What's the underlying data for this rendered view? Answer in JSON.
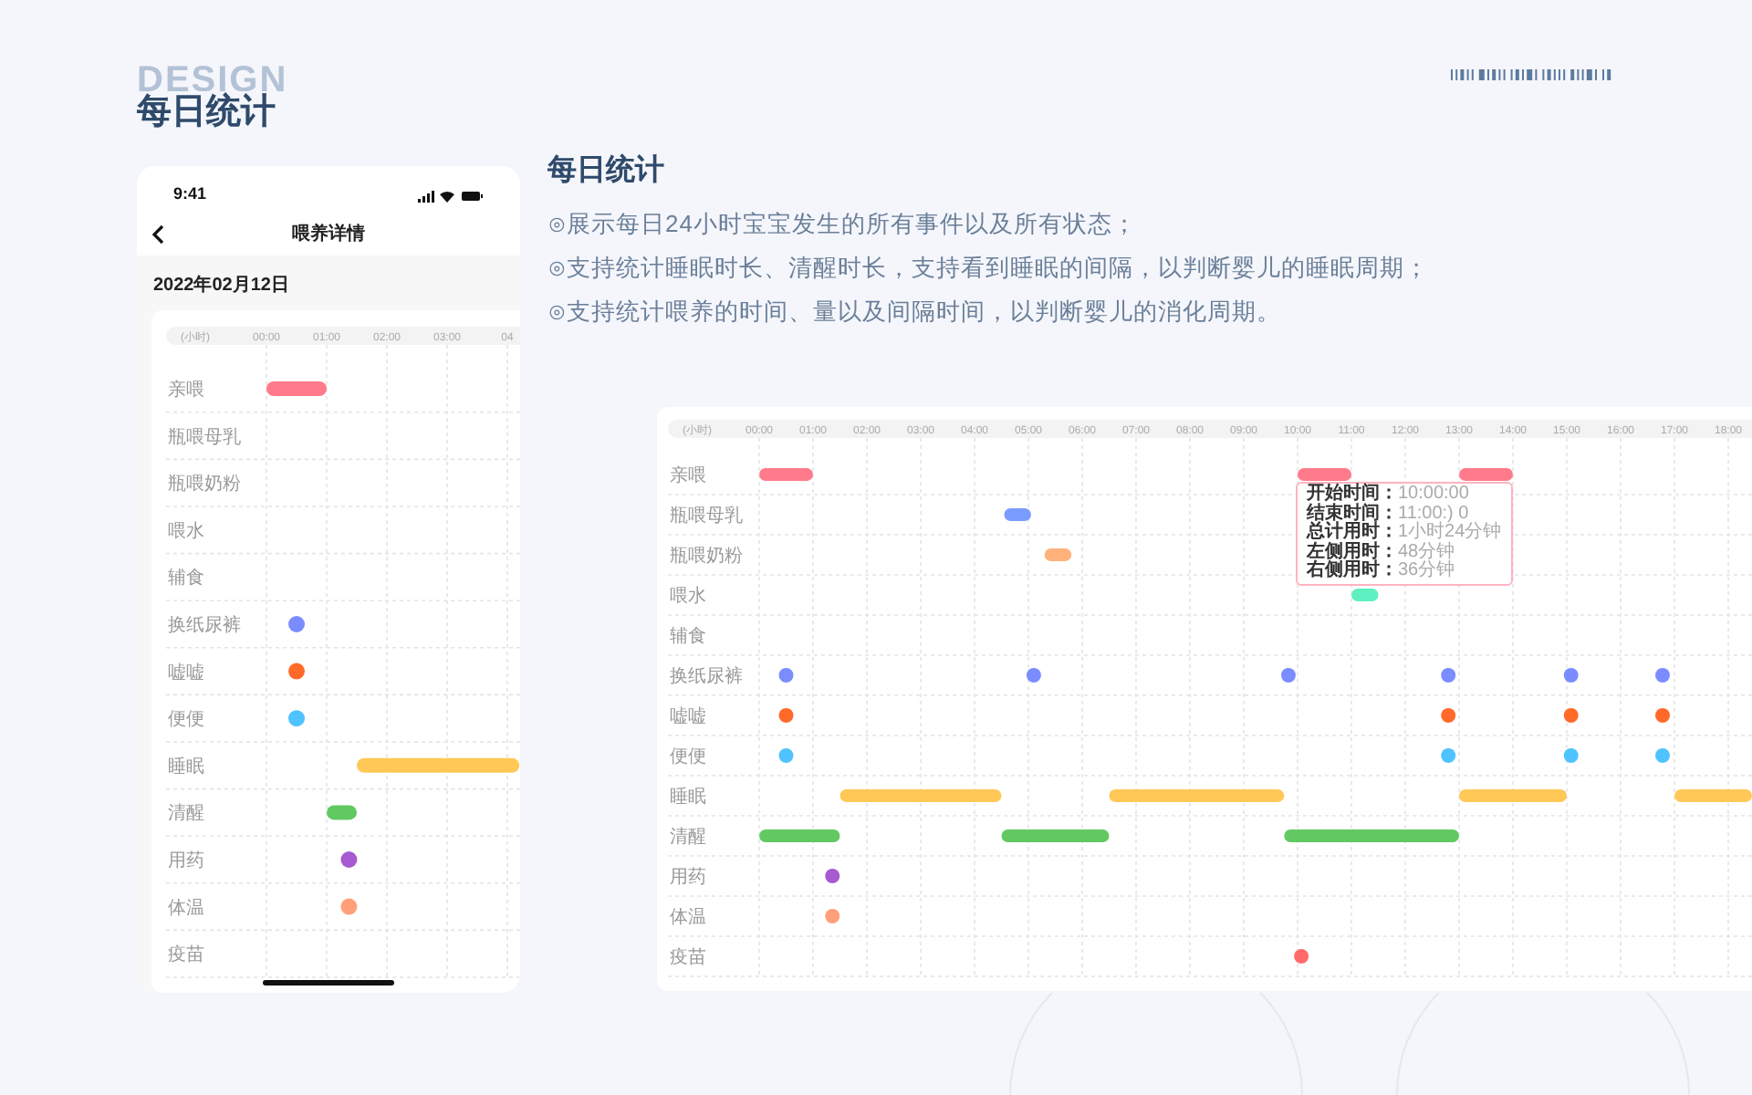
{
  "header": {
    "watermark_word": "DESIGN",
    "title": "每日统计"
  },
  "phone": {
    "status_time": "9:41",
    "nav_title": "喂养详情",
    "date": "2022年02月12日",
    "timeline": {
      "unit_label": "(小时)",
      "ticks": [
        "00:00",
        "01:00",
        "02:00",
        "03:00",
        "04"
      ],
      "rows": [
        {
          "label": "亲喂",
          "color": "#ff7a8a"
        },
        {
          "label": "瓶喂母乳"
        },
        {
          "label": "瓶喂奶粉"
        },
        {
          "label": "喂水"
        },
        {
          "label": "辅食"
        },
        {
          "label": "换纸尿裤",
          "color": "#7b8cff"
        },
        {
          "label": "嘘嘘",
          "color": "#ff6a2a"
        },
        {
          "label": "便便",
          "color": "#4fc3ff"
        },
        {
          "label": "睡眠",
          "color": "#ffc857"
        },
        {
          "label": "清醒",
          "color": "#62c962"
        },
        {
          "label": "用药",
          "color": "#a65bd0"
        },
        {
          "label": "体温",
          "color": "#ffa07a"
        },
        {
          "label": "疫苗"
        }
      ]
    }
  },
  "intro": {
    "title": "每日统计",
    "bullets": [
      "⊙展示每日24小时宝宝发生的所有事件以及所有状态；",
      "⊙支持统计睡眠时长、清醒时长，支持看到睡眠的间隔，以判断婴儿的睡眠周期；",
      "⊙支持统计喂养的时间、量以及间隔时间，以判断婴儿的消化周期。"
    ]
  },
  "wide_chart": {
    "timeline": {
      "unit_label": "(小时)",
      "ticks": [
        "00:00",
        "01:00",
        "02:00",
        "03:00",
        "04:00",
        "05:00",
        "06:00",
        "07:00",
        "08:00",
        "09:00",
        "10:00",
        "11:00",
        "12:00",
        "13:00",
        "14:00",
        "15:00",
        "16:00",
        "17:00",
        "18:00"
      ],
      "rows": [
        {
          "label": "亲喂",
          "color": "#ff7a8a"
        },
        {
          "label": "瓶喂母乳",
          "color": "#7b9cff"
        },
        {
          "label": "瓶喂奶粉",
          "color": "#ffb27a"
        },
        {
          "label": "喂水",
          "color": "#5ef0c0"
        },
        {
          "label": "辅食"
        },
        {
          "label": "换纸尿裤",
          "color": "#7b8cff"
        },
        {
          "label": "嘘嘘",
          "color": "#ff6a2a"
        },
        {
          "label": "便便",
          "color": "#4fc3ff"
        },
        {
          "label": "睡眠",
          "color": "#ffc857"
        },
        {
          "label": "清醒",
          "color": "#62c962"
        },
        {
          "label": "用药",
          "color": "#a65bd0"
        },
        {
          "label": "体温",
          "color": "#ffa07a"
        },
        {
          "label": "疫苗",
          "color": "#ff6b6b"
        }
      ]
    },
    "tooltip": [
      "**开始时间：**10:00:00",
      "**结束时间：**11:00:) 0",
      "**总计用时：**1小时24分钟",
      "**左侧用时：**48分钟",
      "**右侧用时：**36分钟"
    ]
  }
}
